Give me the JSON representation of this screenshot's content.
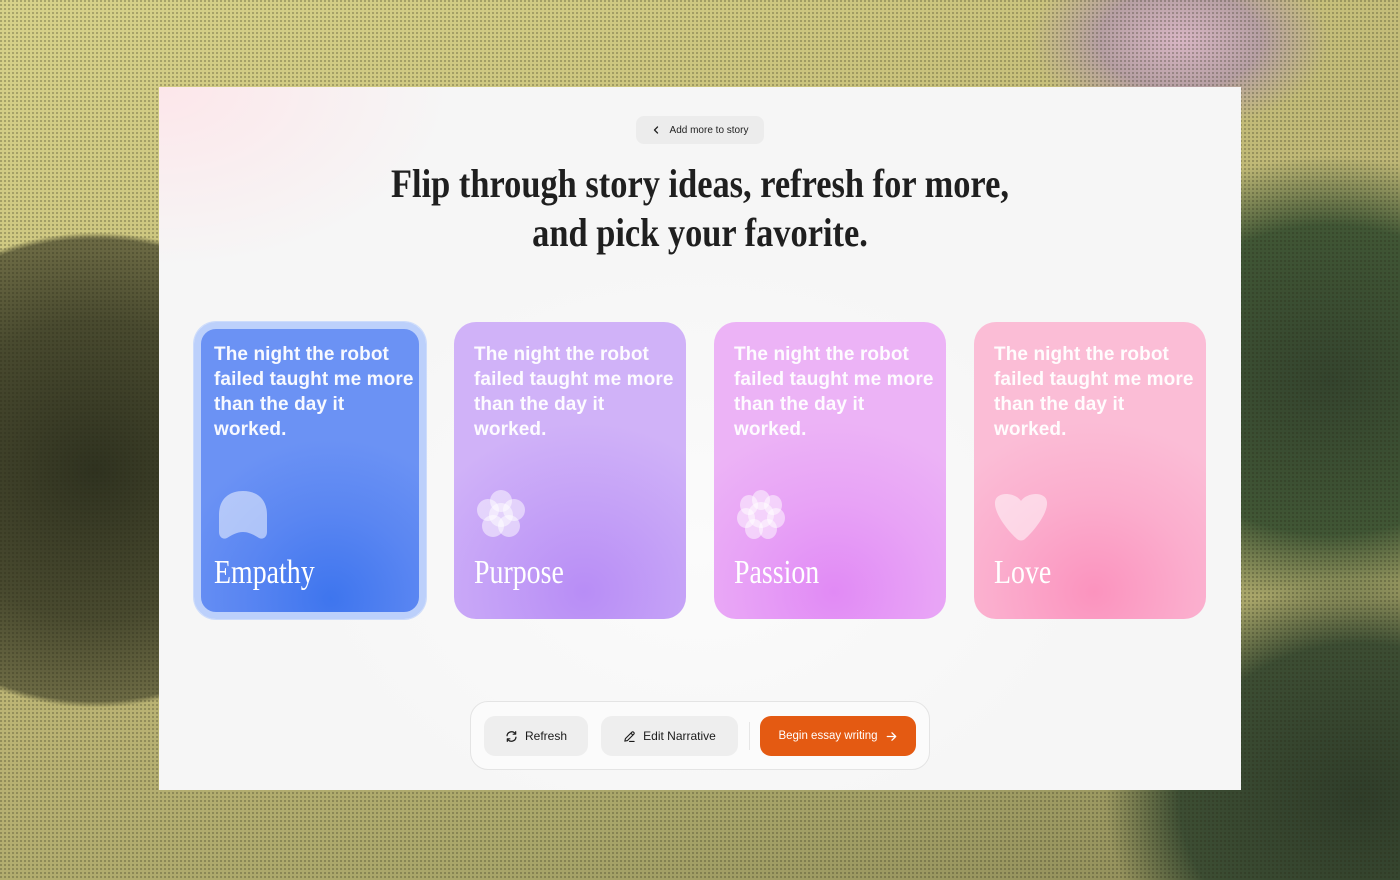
{
  "back_button": {
    "label": "Add more to story",
    "icon": "chevron-left-icon"
  },
  "headline": {
    "line1": "Flip through story ideas, refresh for more,",
    "line2": "and pick your favorite."
  },
  "cards": [
    {
      "quote": "The night the robot failed taught me more than the day it worked.",
      "label": "Empathy",
      "shape": "arch-shape-icon",
      "selected": true,
      "color": "#5a86f2"
    },
    {
      "quote": "The night the robot failed taught me more than the day it worked.",
      "label": "Purpose",
      "shape": "flower-shape-icon",
      "selected": false,
      "color": "#c5a2f7"
    },
    {
      "quote": "The night the robot failed taught me more than the day it worked.",
      "label": "Passion",
      "shape": "flower-shape-icon",
      "selected": false,
      "color": "#e8a3f6"
    },
    {
      "quote": "The night the robot failed taught me more than the day it worked.",
      "label": "Love",
      "shape": "heart-shape-icon",
      "selected": false,
      "color": "#fbadcd"
    }
  ],
  "actions": {
    "refresh_label": "Refresh",
    "refresh_icon": "refresh-icon",
    "edit_label": "Edit Narrative",
    "edit_icon": "pencil-icon",
    "begin_label": "Begin essay writing",
    "begin_icon": "arrow-right-icon",
    "accent_color": "#e45a12"
  }
}
